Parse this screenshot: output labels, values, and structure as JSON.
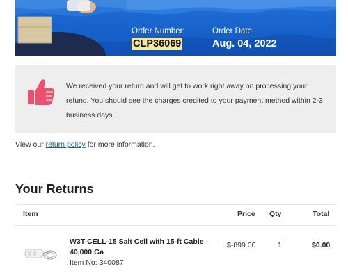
{
  "order": {
    "number_label": "Order Number:",
    "number": "CLP36069",
    "date_label": "Order Date:",
    "date": "Aug. 04, 2022"
  },
  "message": {
    "text": "We received your return and will get to work right away on processing your refund. You should see the charges credited to your payment method within 2-3 business days."
  },
  "policy": {
    "prefix": "View our ",
    "link": "return policy",
    "suffix": " for more information."
  },
  "returns": {
    "title": "Your Returns",
    "columns": {
      "item": "Item",
      "price": "Price",
      "qty": "Qty",
      "total": "Total"
    },
    "items": [
      {
        "name": "W3T-CELL-15 Salt Cell with 15-ft Cable - 40,000 Ga",
        "item_no": "Item No: 340087",
        "price": "$-899.00",
        "qty": "1",
        "total": "$0.00"
      }
    ]
  },
  "colors": {
    "banner_blue": "#1565c0",
    "highlight": "#f3e89a",
    "thumb_pink": "#ef4f6e",
    "link": "#1a5fb4"
  },
  "icons": {
    "thumb": "thumbs-up-icon",
    "product": "salt-cell-product-image"
  }
}
